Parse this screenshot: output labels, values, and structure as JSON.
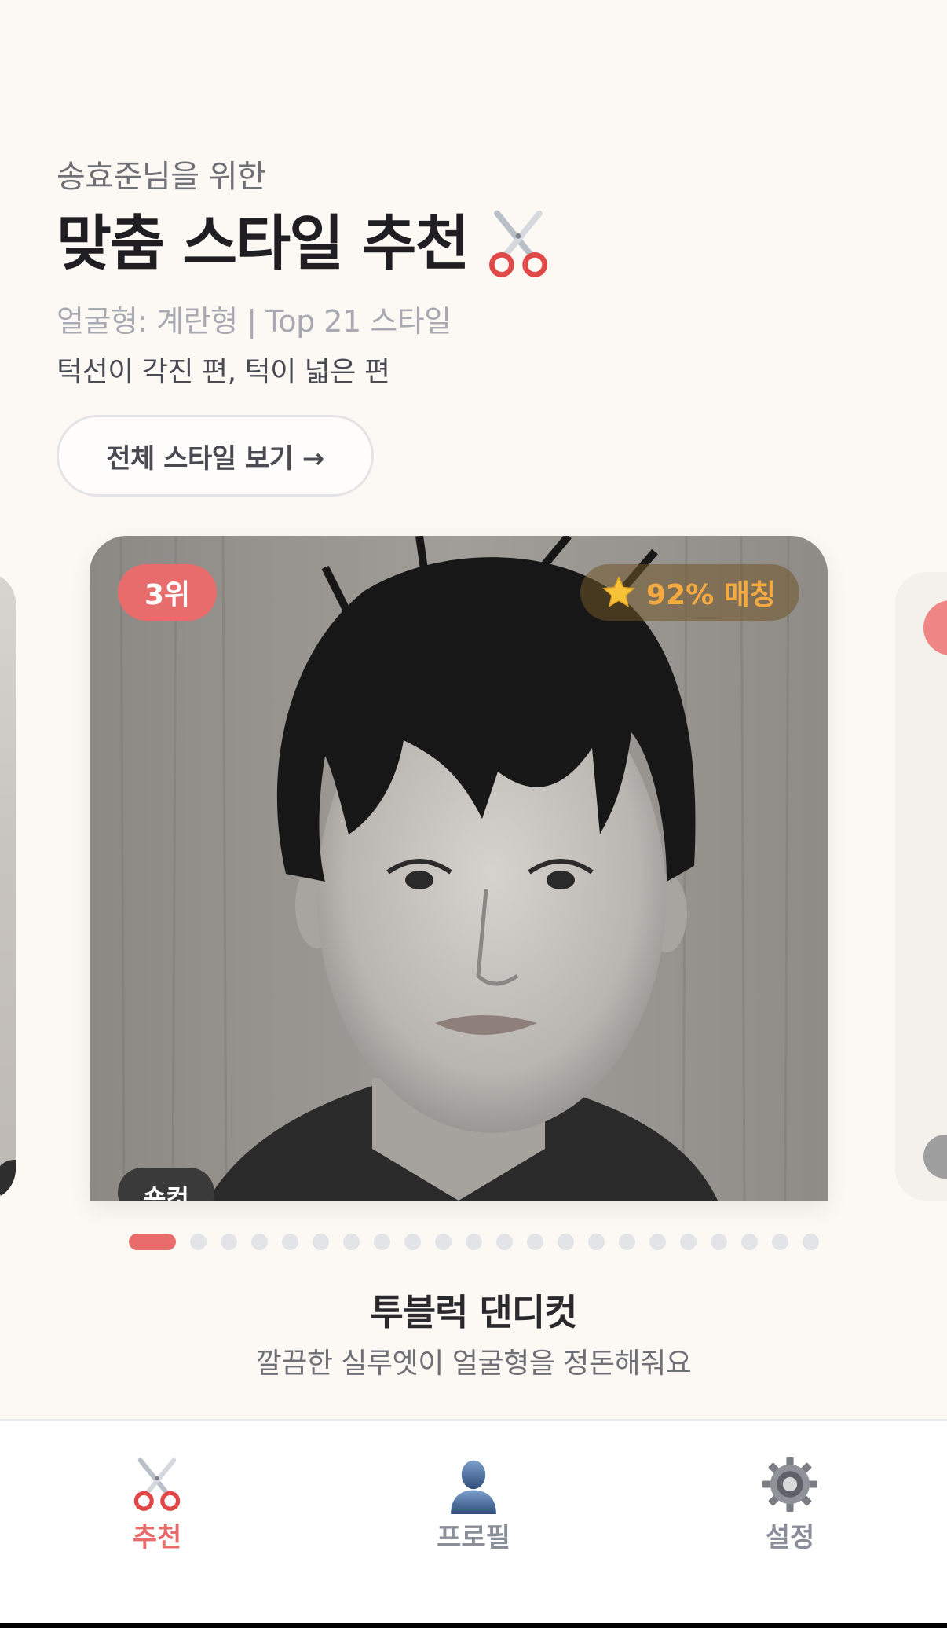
{
  "header": {
    "subtitle": "송효준님을 위한",
    "title": "맞춤 스타일 추천",
    "face_info": "얼굴형: 계란형 | Top 21 스타일",
    "jaw_info": "턱선이 각진 편, 턱이 넓은 편",
    "view_all_label": "전체 스타일 보기 →"
  },
  "card": {
    "rank": "3위",
    "match": "92% 매칭",
    "category": "숏컷"
  },
  "carousel": {
    "total": 22,
    "active_index": 0
  },
  "style": {
    "name": "투블럭 댄디컷",
    "description": "깔끔한 실루엣이 얼굴형을 정돈해줘요"
  },
  "tabs": [
    {
      "label": "추천",
      "icon": "scissors-icon",
      "active": true
    },
    {
      "label": "프로필",
      "icon": "user-icon",
      "active": false
    },
    {
      "label": "설정",
      "icon": "gear-icon",
      "active": false
    }
  ],
  "colors": {
    "accent": "#e86c6c",
    "match": "#f5a941",
    "background": "#fcf9f5"
  }
}
